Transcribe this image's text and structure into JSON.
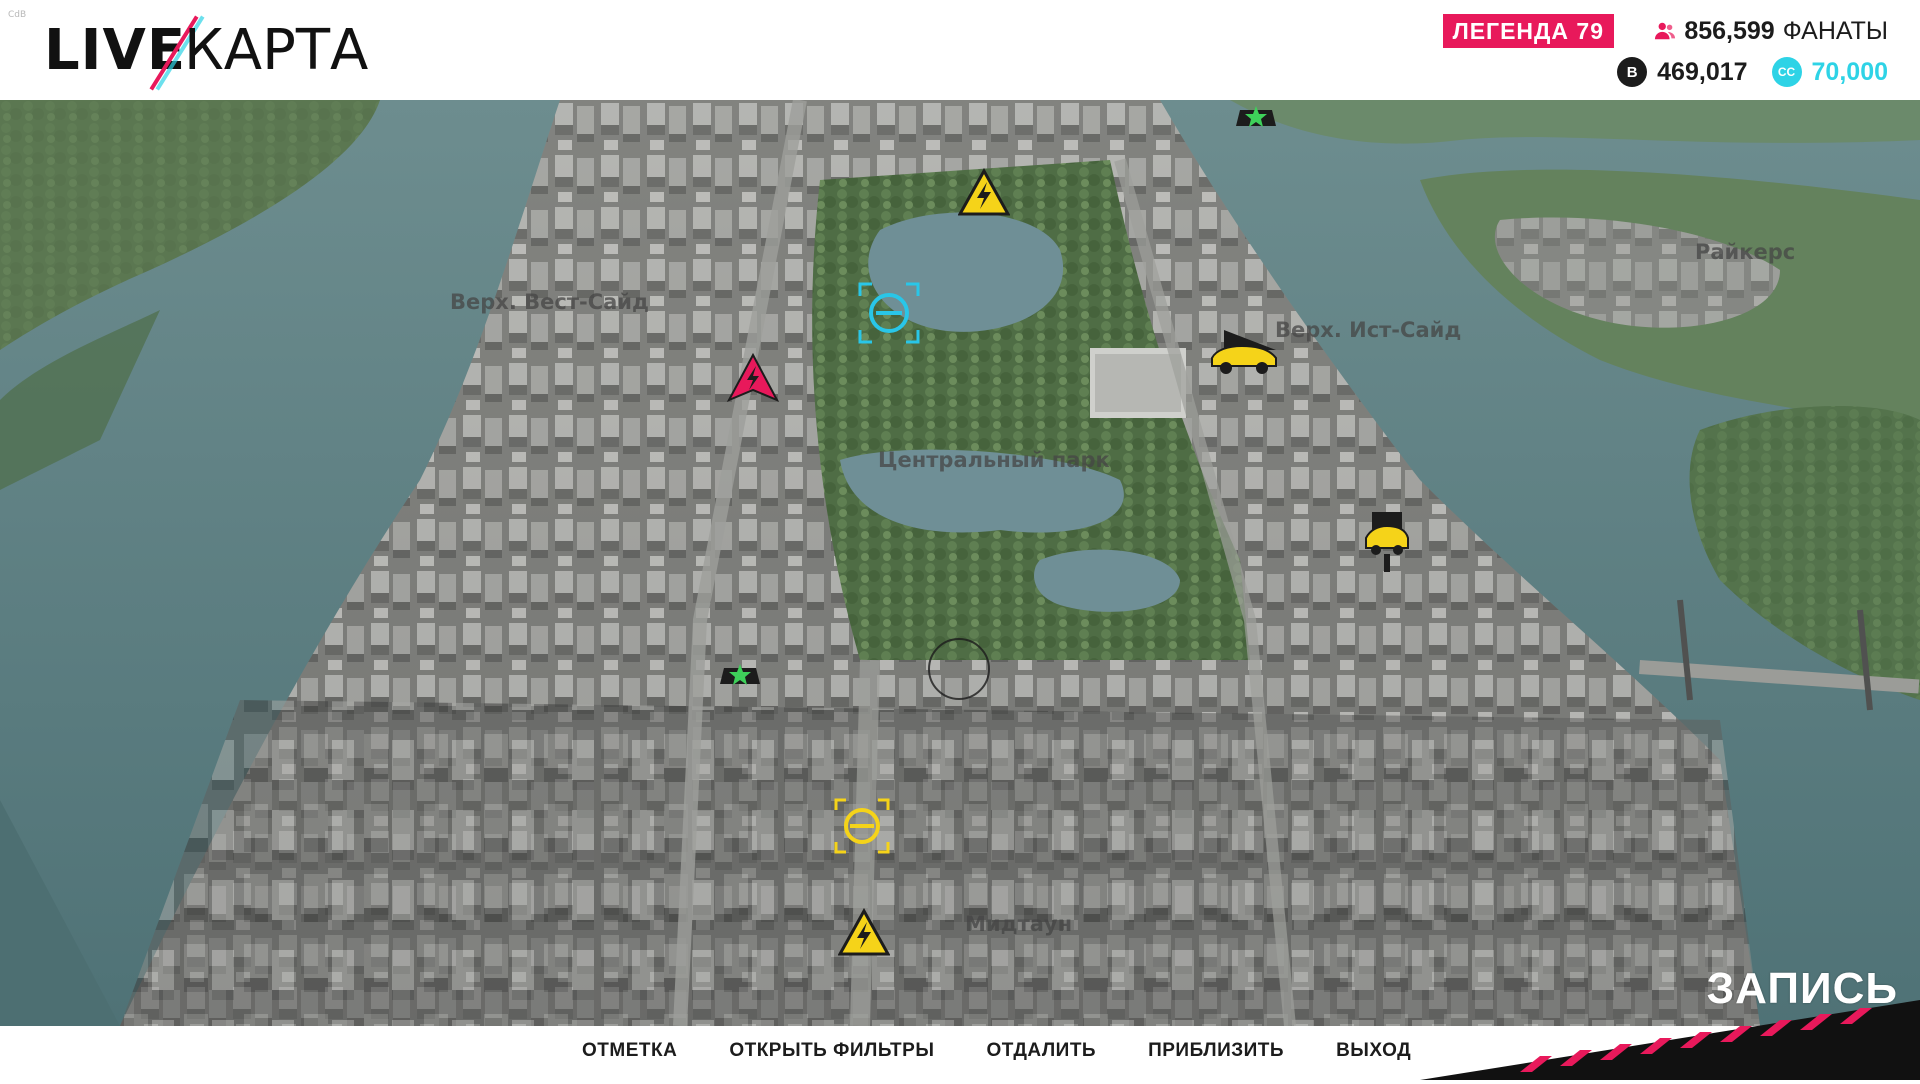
{
  "window": {
    "corner_tag": "CdB"
  },
  "header": {
    "logo_live": "LIVE",
    "logo_karta": "КАРТА",
    "legend_badge": "ЛЕГЕНДА 79",
    "fans_count": "856,599",
    "fans_label": "ФАНАТЫ",
    "bucks": "469,017",
    "crew_credits": "70,000",
    "bucks_icon_text": "B",
    "crew_icon_text": "CC"
  },
  "map": {
    "districts": [
      {
        "id": "upper-west-side",
        "label": "Верх. Вест-Сайд"
      },
      {
        "id": "upper-east-side",
        "label": "Верх. Ист-Сайд"
      },
      {
        "id": "central-park",
        "label": "Центральный парк"
      },
      {
        "id": "rikers",
        "label": "Райкерс"
      },
      {
        "id": "midtown",
        "label": "Мидтаун"
      }
    ],
    "markers": [
      {
        "id": "hazard-north",
        "icon": "warning-bolt-icon",
        "color": "#f5d319"
      },
      {
        "id": "hazard-midtown",
        "icon": "warning-bolt-icon",
        "color": "#f5d319"
      },
      {
        "id": "race-red",
        "icon": "race-bolt-icon",
        "color": "#e8195b"
      },
      {
        "id": "target-cyan",
        "icon": "target-icon",
        "color": "#29c6e8"
      },
      {
        "id": "target-yellow",
        "icon": "target-icon",
        "color": "#f5d319"
      },
      {
        "id": "car-east-1",
        "icon": "car-icon",
        "color": "#f5d319"
      },
      {
        "id": "car-east-2",
        "icon": "car-icon",
        "color": "#f5d319"
      },
      {
        "id": "star-north",
        "icon": "star-icon",
        "color": "#3ed15a"
      },
      {
        "id": "star-west",
        "icon": "star-icon",
        "color": "#3ed15a"
      },
      {
        "id": "cursor",
        "icon": "cursor-ring-icon",
        "color": "#1c1c1c"
      }
    ]
  },
  "bottom_bar": {
    "actions": [
      "ОТМЕТКА",
      "ОТКРЫТЬ ФИЛЬТРЫ",
      "ОТДАЛИТЬ",
      "ПРИБЛИЗИТЬ",
      "ВЫХОД"
    ],
    "record_label": "ЗАПИСЬ"
  },
  "colors": {
    "accent_pink": "#e8195b",
    "accent_cyan": "#2ed3e6",
    "marker_yellow": "#f5d319",
    "text_dark": "#1c1c1c"
  }
}
